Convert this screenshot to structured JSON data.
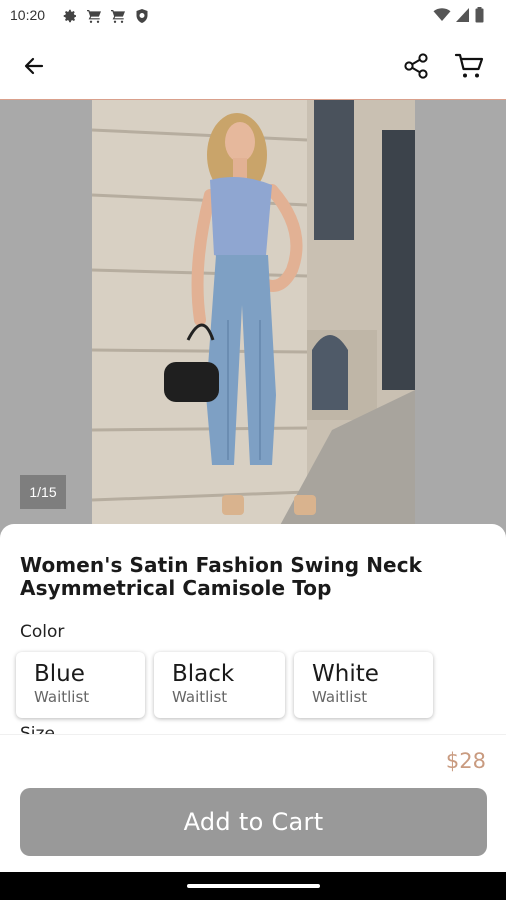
{
  "status_bar": {
    "time": "10:20",
    "left_icons": [
      "gear-icon",
      "cart-icon",
      "cart-icon",
      "shield-icon"
    ],
    "right_icons": [
      "wifi-icon",
      "signal-icon",
      "battery-icon"
    ]
  },
  "app_bar": {
    "back_icon": "arrow-left-icon",
    "share_icon": "share-icon",
    "cart_icon": "cart-icon"
  },
  "gallery": {
    "counter": "1/15"
  },
  "product": {
    "title": "Women's Satin Fashion Swing Neck Asymmetrical Camisole Top",
    "color_label": "Color",
    "colors": [
      {
        "name": "Blue",
        "status": "Waitlist"
      },
      {
        "name": "Black",
        "status": "Waitlist"
      },
      {
        "name": "White",
        "status": "Waitlist"
      }
    ],
    "size_label": "Size"
  },
  "footer": {
    "price": "$28",
    "add_to_cart": "Add to Cart"
  },
  "colors": {
    "price": "#c99b80",
    "button_disabled": "#999999",
    "app_bar_divider": "#d9a08c"
  }
}
